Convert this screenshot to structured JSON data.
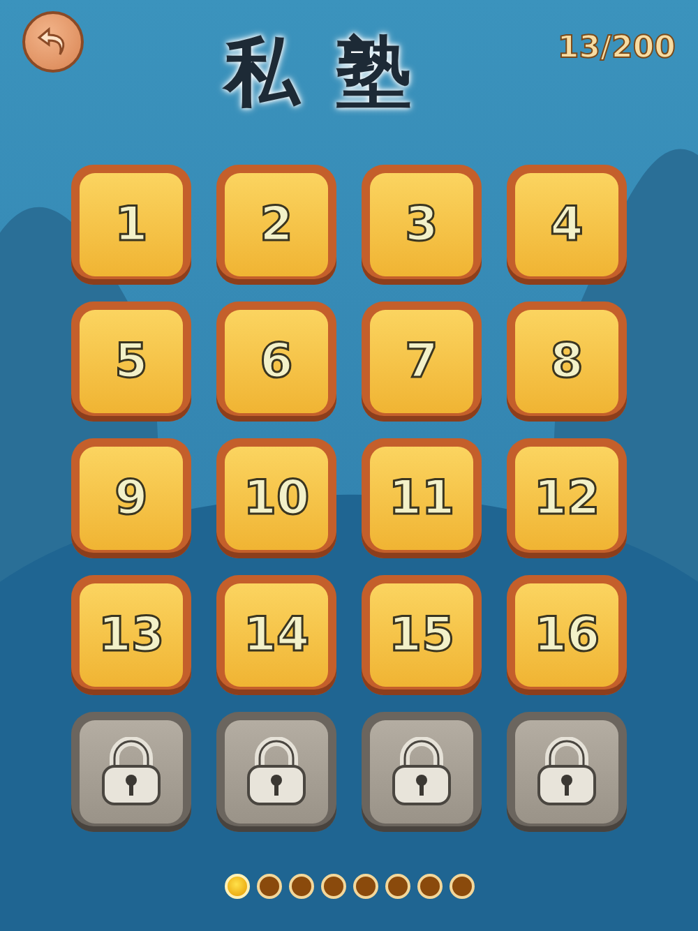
{
  "header": {
    "title": "私 塾",
    "progress": "13/200"
  },
  "levels": [
    {
      "kind": "level",
      "label": "1"
    },
    {
      "kind": "level",
      "label": "2"
    },
    {
      "kind": "level",
      "label": "3"
    },
    {
      "kind": "level",
      "label": "4"
    },
    {
      "kind": "level",
      "label": "5"
    },
    {
      "kind": "level",
      "label": "6"
    },
    {
      "kind": "level",
      "label": "7"
    },
    {
      "kind": "level",
      "label": "8"
    },
    {
      "kind": "level",
      "label": "9"
    },
    {
      "kind": "level",
      "label": "10"
    },
    {
      "kind": "level",
      "label": "11"
    },
    {
      "kind": "level",
      "label": "12"
    },
    {
      "kind": "level",
      "label": "13"
    },
    {
      "kind": "level",
      "label": "14"
    },
    {
      "kind": "level",
      "label": "15"
    },
    {
      "kind": "level",
      "label": "16"
    },
    {
      "kind": "locked"
    },
    {
      "kind": "locked"
    },
    {
      "kind": "locked"
    },
    {
      "kind": "locked"
    }
  ],
  "pages": [
    {
      "selected": true
    },
    {
      "selected": false
    },
    {
      "selected": false
    },
    {
      "selected": false
    },
    {
      "selected": false
    },
    {
      "selected": false
    },
    {
      "selected": false
    },
    {
      "selected": false
    }
  ]
}
